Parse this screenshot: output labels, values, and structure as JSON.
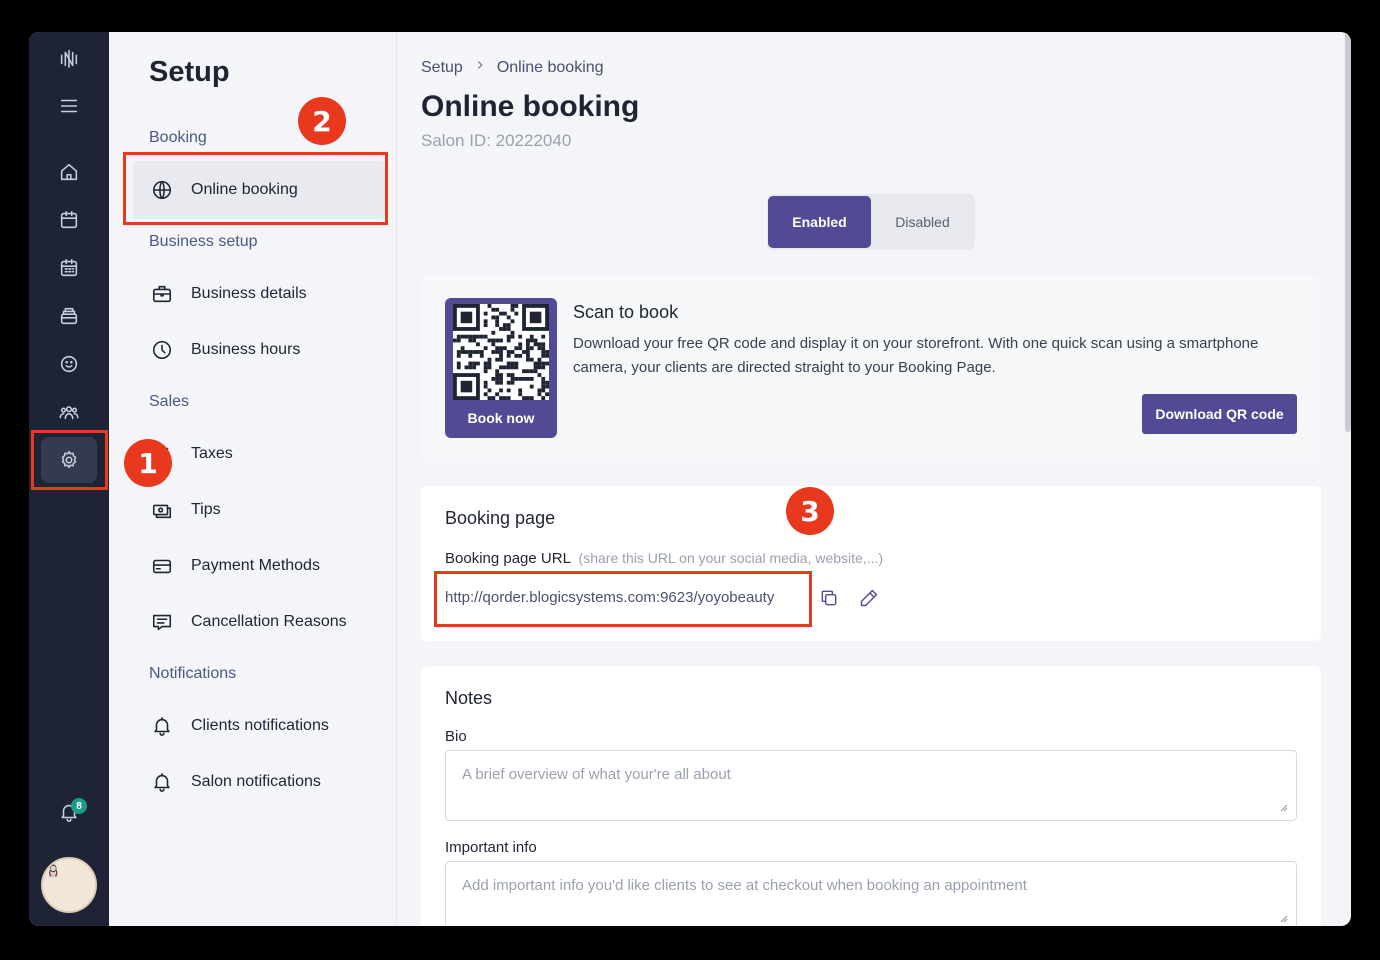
{
  "rail": {
    "icons": [
      "logo-icon",
      "menu-icon",
      "home-icon",
      "calendar-icon",
      "calendar-grid-icon",
      "inventory-icon",
      "clients-icon",
      "team-icon",
      "settings-icon",
      "notifications-icon"
    ],
    "notification_count": "8"
  },
  "menu": {
    "title": "Setup",
    "sections": {
      "booking": "Booking",
      "business_setup": "Business setup",
      "sales": "Sales",
      "notifications": "Notifications"
    },
    "items": {
      "online_booking": "Online booking",
      "business_details": "Business details",
      "business_hours": "Business hours",
      "taxes": "Taxes",
      "tips": "Tips",
      "payment_methods": "Payment Methods",
      "cancellation_reasons": "Cancellation Reasons",
      "clients_notifications": "Clients notifications",
      "salon_notifications": "Salon notifications"
    }
  },
  "breadcrumb": [
    "Setup",
    "Online booking"
  ],
  "page": {
    "title": "Online booking",
    "salon_id": "Salon ID: 20222040"
  },
  "toggle": {
    "enabled": "Enabled",
    "disabled": "Disabled",
    "selected": "Enabled"
  },
  "qr": {
    "label": "Book now",
    "heading": "Scan to book",
    "description": "Download your free QR code and display it on your storefront. With one quick scan using a smartphone camera, your clients are directed straight to your Booking Page.",
    "download_button": "Download QR code"
  },
  "booking_page": {
    "heading": "Booking page",
    "url_label": "Booking page URL",
    "url_hint": "(share this URL on your social media, website,...)",
    "url": "http://qorder.blogicsystems.com:9623/yoyobeauty"
  },
  "notes": {
    "heading": "Notes",
    "bio_label": "Bio",
    "bio_placeholder": "A brief overview of what your're all about",
    "important_label": "Important info",
    "important_placeholder": "Add important info you'd like clients to see at checkout when booking an appointment"
  },
  "annotations": [
    "1",
    "2",
    "3"
  ],
  "colors": {
    "accent": "#514b95",
    "annotation": "#e8391f",
    "rail": "#1e2436"
  }
}
